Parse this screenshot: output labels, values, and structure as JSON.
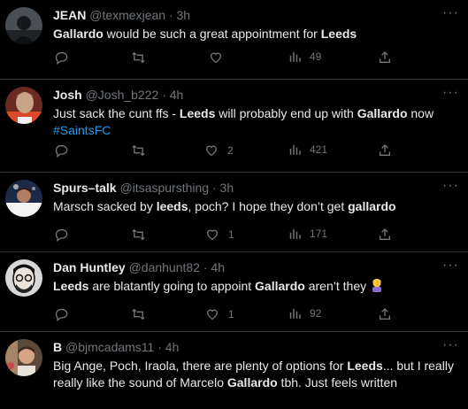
{
  "tweets": [
    {
      "name": "JEAN",
      "handle": "@texmexjean",
      "time": "3h",
      "text_parts": [
        {
          "t": "Gallardo",
          "bold": true
        },
        {
          "t": " would be such a great appointment for ",
          "bold": false
        },
        {
          "t": "Leeds",
          "bold": true
        }
      ],
      "replies": "",
      "retweets": "",
      "likes": "",
      "views": "49"
    },
    {
      "name": "Josh",
      "handle": "@Josh_b222",
      "time": "4h",
      "text_parts": [
        {
          "t": "Just sack the cunt ffs - ",
          "bold": false
        },
        {
          "t": "Leeds",
          "bold": true
        },
        {
          "t": " will probably end up with ",
          "bold": false
        },
        {
          "t": "Gallardo",
          "bold": true
        },
        {
          "t": " now",
          "bold": false
        }
      ],
      "hashtag": "#SaintsFC",
      "replies": "",
      "retweets": "",
      "likes": "2",
      "views": "421"
    },
    {
      "name": "Spurs–talk",
      "handle": "@itsaspursthing",
      "time": "3h",
      "text_parts": [
        {
          "t": "Marsch sacked by ",
          "bold": false
        },
        {
          "t": "leeds",
          "bold": true
        },
        {
          "t": ", poch? I hope they don’t get ",
          "bold": false
        },
        {
          "t": "gallardo",
          "bold": true
        }
      ],
      "replies": "",
      "retweets": "",
      "likes": "1",
      "views": "171"
    },
    {
      "name": "Dan Huntley",
      "handle": "@danhunt82",
      "time": "4h",
      "text_parts": [
        {
          "t": "Leeds",
          "bold": true
        },
        {
          "t": " are blatantly going to appoint ",
          "bold": false
        },
        {
          "t": "Gallardo",
          "bold": true
        },
        {
          "t": " aren’t they ",
          "bold": false
        }
      ],
      "emoji": "person-facepalming",
      "replies": "",
      "retweets": "",
      "likes": "1",
      "views": "92"
    },
    {
      "name": "B",
      "handle": "@bjmcadams11",
      "time": "4h",
      "text_parts": [
        {
          "t": "Big Ange, Poch, Iraola, there are plenty of options for ",
          "bold": false
        },
        {
          "t": "Leeds",
          "bold": true
        },
        {
          "t": "... but I really really like the sound of Marcelo ",
          "bold": false
        },
        {
          "t": "Gallardo",
          "bold": true
        },
        {
          "t": " tbh. Just feels written",
          "bold": false
        }
      ]
    }
  ],
  "colors": {
    "background": "#000000",
    "text": "#e7e9ea",
    "muted": "#71767b",
    "link": "#1d9bf0",
    "divider": "#2f3336"
  },
  "icons": [
    "reply-icon",
    "retweet-icon",
    "like-icon",
    "views-icon",
    "share-icon",
    "more-icon"
  ]
}
